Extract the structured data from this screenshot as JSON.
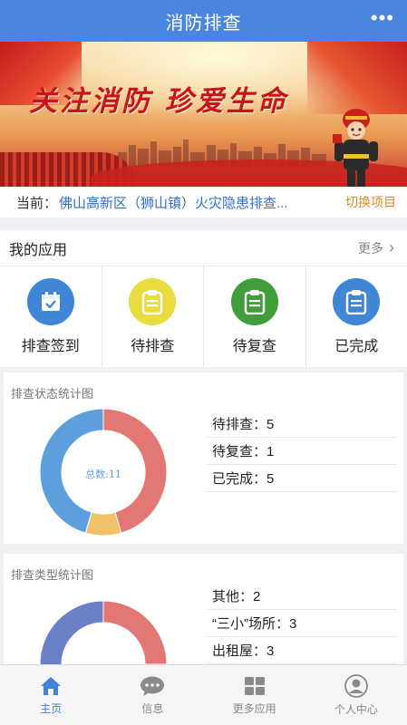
{
  "header": {
    "title": "消防排查",
    "more_icon": "more-dots-icon"
  },
  "banner": {
    "slogan": "关注消防 珍爱生命"
  },
  "project": {
    "label": "当前：",
    "name": "佛山高新区（狮山镇）火灾隐患排查...",
    "switch_label": "切换项目"
  },
  "apps": {
    "title": "我的应用",
    "more_label": "更多",
    "items": [
      {
        "label": "排查签到",
        "icon": "calendar-check-icon",
        "color": "#3f86d6"
      },
      {
        "label": "待排查",
        "icon": "clipboard-icon",
        "color": "#e8dc3e"
      },
      {
        "label": "待复查",
        "icon": "clipboard-icon",
        "color": "#3f9e3a"
      },
      {
        "label": "已完成",
        "icon": "clipboard-icon",
        "color": "#3f86d6"
      }
    ]
  },
  "status_chart": {
    "title": "排查状态统计图",
    "center_label": "总数:11",
    "rows": [
      "待排查：5",
      "待复查：1",
      "已完成：5"
    ]
  },
  "type_chart": {
    "title": "排查类型统计图",
    "rows": [
      "其他：2",
      "“三小”场所：3",
      "出租屋：3"
    ]
  },
  "chart_data": [
    {
      "type": "pie",
      "title": "排查状态统计图",
      "categories": [
        "待排查",
        "待复查",
        "已完成"
      ],
      "values": [
        5,
        1,
        5
      ],
      "colors": [
        "#e37774",
        "#f0c36a",
        "#5d9fdc"
      ],
      "total_label": "总数:11"
    },
    {
      "type": "pie",
      "title": "排查类型统计图",
      "categories": [
        "其他",
        "“三小”场所",
        "出租屋"
      ],
      "values": [
        2,
        3,
        3
      ],
      "colors": [
        "#e37774",
        "#f0c36a",
        "#6b7fc6",
        "#6fc2b8",
        "#3aa6a0"
      ]
    }
  ],
  "tabbar": {
    "tabs": [
      {
        "label": "主页",
        "icon": "home-icon",
        "active": true
      },
      {
        "label": "信息",
        "icon": "chat-icon",
        "active": false
      },
      {
        "label": "更多应用",
        "icon": "grid-icon",
        "active": false
      },
      {
        "label": "个人中心",
        "icon": "user-icon",
        "active": false
      }
    ]
  },
  "colors": {
    "primary": "#4a86e0",
    "accent": "#e08b2d",
    "link": "#2f6fc4"
  }
}
